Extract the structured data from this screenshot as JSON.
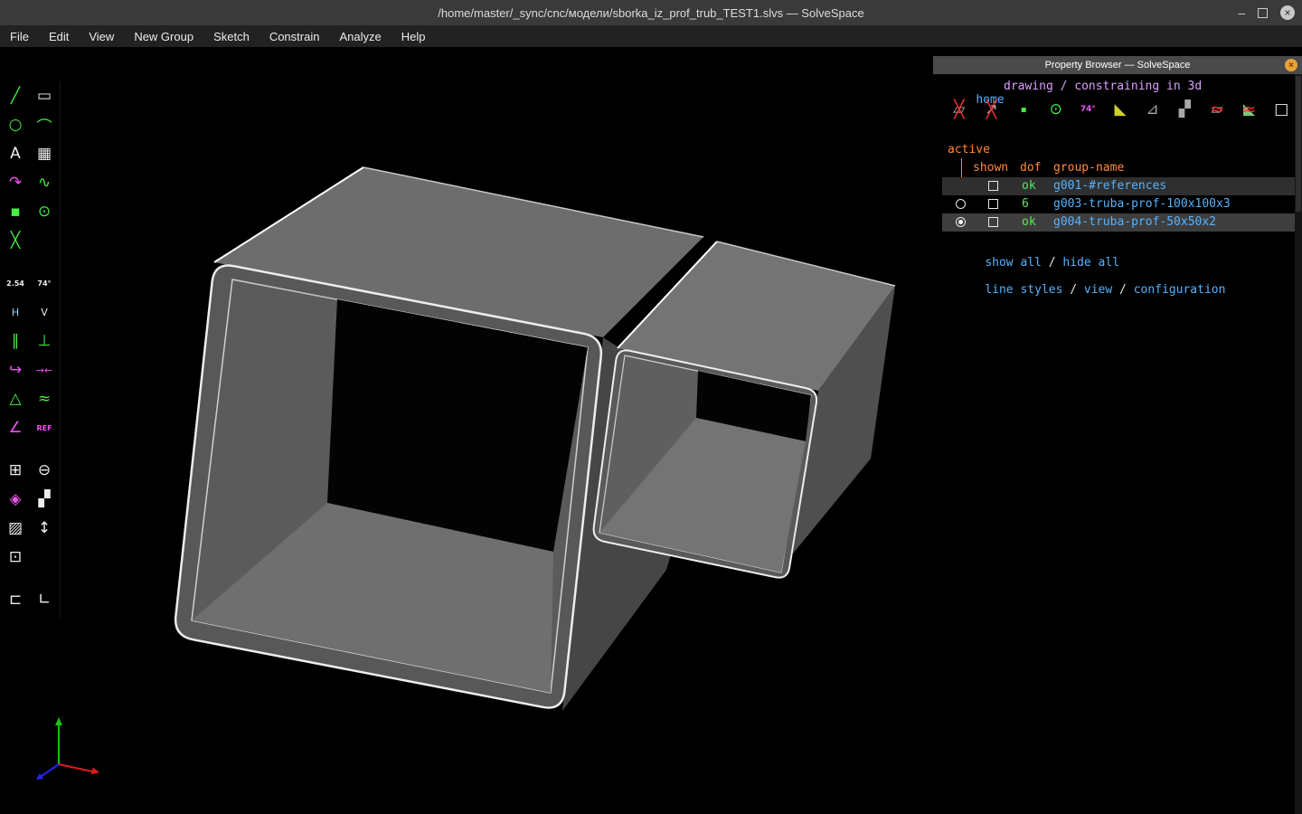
{
  "window": {
    "title": "/home/master/_sync/cnc/модели/sborka_iz_prof_trub_TEST1.slvs — SolveSpace",
    "minimize_glyph": "–",
    "close_glyph": "×"
  },
  "menu": {
    "items": [
      "File",
      "Edit",
      "View",
      "New Group",
      "Sketch",
      "Constrain",
      "Analyze",
      "Help"
    ]
  },
  "left_toolbar": {
    "icons": [
      {
        "name": "line-segment",
        "glyph": "╱"
      },
      {
        "name": "rectangle",
        "glyph": "▭"
      },
      {
        "name": "circle",
        "glyph": "○"
      },
      {
        "name": "arc",
        "glyph": "⌒"
      },
      {
        "name": "text",
        "glyph": "A"
      },
      {
        "name": "image",
        "glyph": "▦"
      },
      {
        "name": "tangent-arc",
        "glyph": "↷"
      },
      {
        "name": "cubic-bezier",
        "glyph": "∿"
      },
      {
        "name": "datum-point",
        "glyph": "▪"
      },
      {
        "name": "construction",
        "glyph": "⊙"
      },
      {
        "name": "split-curves",
        "glyph": "╳"
      },
      {
        "name": "distance-dimension",
        "glyph": "2.54"
      },
      {
        "name": "angle-dimension",
        "glyph": "74°"
      },
      {
        "name": "horizontal-constraint",
        "glyph": "H"
      },
      {
        "name": "vertical-constraint",
        "glyph": "V"
      },
      {
        "name": "parallel-constraint",
        "glyph": "∥"
      },
      {
        "name": "perpendicular-constraint",
        "glyph": "⊥"
      },
      {
        "name": "tangent-constraint",
        "glyph": "↪"
      },
      {
        "name": "symmetric-constraint",
        "glyph": "→←"
      },
      {
        "name": "equal-constraint",
        "glyph": "△"
      },
      {
        "name": "same-curvature-constraint",
        "glyph": "≈"
      },
      {
        "name": "other-angle-constraint",
        "glyph": "∠"
      },
      {
        "name": "reference-constraint",
        "glyph": "REF"
      },
      {
        "name": "extrude-group",
        "glyph": "⊞"
      },
      {
        "name": "lathe-group",
        "glyph": "⊖"
      },
      {
        "name": "revolve-group",
        "glyph": "◈"
      },
      {
        "name": "step-translate-group",
        "glyph": "▞"
      },
      {
        "name": "step-rotate-group",
        "glyph": "▨"
      },
      {
        "name": "helix-group",
        "glyph": "↕"
      },
      {
        "name": "sketch-in-3d",
        "glyph": "⊡"
      },
      {
        "name": "link-file",
        "glyph": "⊏"
      },
      {
        "name": "link-frame",
        "glyph": "∟"
      }
    ]
  },
  "viewport": {
    "axes": {
      "x_color": "#e01b1b",
      "y_color": "#18c418",
      "z_color": "#2424ee"
    },
    "model_color": "#5a5a5a",
    "background": "#000000"
  },
  "property_browser": {
    "title": "Property Browser — SolveSpace",
    "close_glyph": "×",
    "nav": {
      "home": "home",
      "context": "drawing / constraining in 3d"
    },
    "toolbar": [
      {
        "name": "workplanes-toggle",
        "base": "▱",
        "overlay": "╳"
      },
      {
        "name": "normals-toggle",
        "base": "↗",
        "overlay": "╳"
      },
      {
        "name": "points-toggle",
        "base": "▪",
        "overlay": ""
      },
      {
        "name": "constraints-toggle",
        "base": "⊙",
        "overlay": ""
      },
      {
        "name": "dimensions-toggle",
        "base": "74°",
        "overlay": ""
      },
      {
        "name": "shaded-toggle",
        "base": "◣",
        "overlay": ""
      },
      {
        "name": "edges-toggle",
        "base": "⊿",
        "overlay": ""
      },
      {
        "name": "outlines-toggle",
        "base": "▞",
        "overlay": ""
      },
      {
        "name": "mesh-toggle",
        "base": "▱",
        "overlay": "≈"
      },
      {
        "name": "hidden-lines-toggle",
        "base": "◣",
        "overlay": "≈"
      },
      {
        "name": "occluded-toggle",
        "base": "□",
        "overlay": ""
      }
    ],
    "active_label": "active",
    "header": {
      "shown": "shown",
      "dof": "dof",
      "group_name": "group-name"
    },
    "groups": [
      {
        "dof": "ok",
        "name": "g001-#references"
      },
      {
        "dof": "6",
        "name": "g003-truba-prof-100x100x3"
      },
      {
        "dof": "ok",
        "name": "g004-truba-prof-50x50x2"
      }
    ],
    "links": {
      "show_all": "show all",
      "hide_all": "hide all",
      "line_styles": "line styles",
      "view": "view",
      "configuration": "configuration",
      "sep": " / "
    },
    "colors": {
      "link": "#55b2ff",
      "context": "#d9a0ff",
      "section": "#ff8a3c",
      "ok": "#5ce65c"
    }
  }
}
